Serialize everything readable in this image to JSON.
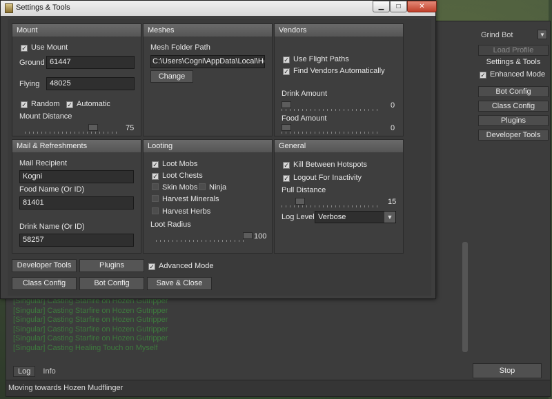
{
  "main_window": {
    "right_panel": {
      "profile_type": "Grind Bot",
      "load_profile": "Load Profile",
      "settings_tools": "Settings & Tools",
      "enhanced_mode": "Enhanced Mode",
      "bot_config": "Bot Config",
      "class_config": "Class Config",
      "plugins": "Plugins",
      "developer_tools": "Developer Tools"
    },
    "log_lines": [
      "[Singular] Casting Starfire on Hozen Gutripper",
      "[Singular] Casting Starfire on Hozen Gutripper",
      "[Singular] Casting Starfire on Hozen Gutripper",
      "[Singular] Casting Starfire on Hozen Gutripper",
      "[Singular] Casting Starfire on Hozen Gutripper",
      "[Singular] Casting Healing Touch on Myself"
    ],
    "tabs": [
      "Log",
      "Info"
    ],
    "stop": "Stop",
    "status": "Moving towards Hozen Mudflinger"
  },
  "dialog": {
    "title": "Settings & Tools",
    "window_buttons": [
      "▁",
      "□",
      "✕"
    ],
    "mount": {
      "header": "Mount",
      "use_mount": "Use Mount",
      "ground_label": "Ground",
      "ground_value": "61447",
      "flying_label": "Flying",
      "flying_value": "48025",
      "random": "Random",
      "automatic": "Automatic",
      "distance_label": "Mount Distance",
      "distance_value": "75",
      "distance_fraction": 0.75
    },
    "meshes": {
      "header": "Meshes",
      "folder_label": "Mesh Folder Path",
      "folder_value": "C:\\Users\\Cogni\\AppData\\Local\\Hon",
      "change": "Change"
    },
    "vendors": {
      "header": "Vendors",
      "use_flight_paths": "Use Flight Paths",
      "find_vendors": "Find Vendors Automatically",
      "drink_label": "Drink Amount",
      "drink_value": "0",
      "food_label": "Food Amount",
      "food_value": "0"
    },
    "mail": {
      "header": "Mail & Refreshments",
      "recipient_label": "Mail Recipient",
      "recipient_value": "Kogni",
      "food_label": "Food Name (Or ID)",
      "food_value": "81401",
      "drink_label": "Drink Name (Or ID)",
      "drink_value": "58257"
    },
    "looting": {
      "header": "Looting",
      "loot_mobs": "Loot Mobs",
      "loot_chests": "Loot Chests",
      "skin_mobs": "Skin Mobs",
      "ninja": "Ninja",
      "harvest_minerals": "Harvest Minerals",
      "harvest_herbs": "Harvest Herbs",
      "radius_label": "Loot Radius",
      "radius_value": "100"
    },
    "general": {
      "header": "General",
      "kill_between": "Kill Between Hotspots",
      "logout": "Logout For Inactivity",
      "pull_label": "Pull Distance",
      "pull_value": "15",
      "log_level_label": "Log Level",
      "log_level_value": "Verbose"
    },
    "buttons": {
      "developer_tools": "Developer Tools",
      "plugins": "Plugins",
      "advanced_mode": "Advanced Mode",
      "class_config": "Class Config",
      "bot_config": "Bot Config",
      "save_close": "Save & Close"
    }
  }
}
